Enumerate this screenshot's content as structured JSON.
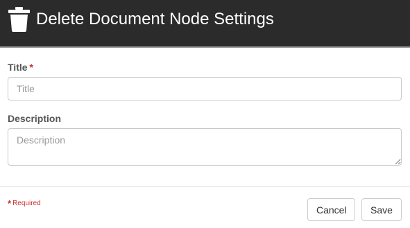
{
  "header": {
    "title": "Delete Document Node Settings",
    "icon": "trash-icon"
  },
  "form": {
    "title_label": "Title",
    "title_required_marker": "*",
    "title_placeholder": "Title",
    "title_value": "",
    "description_label": "Description",
    "description_placeholder": "Description",
    "description_value": ""
  },
  "footer": {
    "required_marker": "*",
    "required_text": "Required",
    "cancel_label": "Cancel",
    "save_label": "Save"
  },
  "colors": {
    "header_bg": "#2b2b2b",
    "required": "#c9302c"
  }
}
